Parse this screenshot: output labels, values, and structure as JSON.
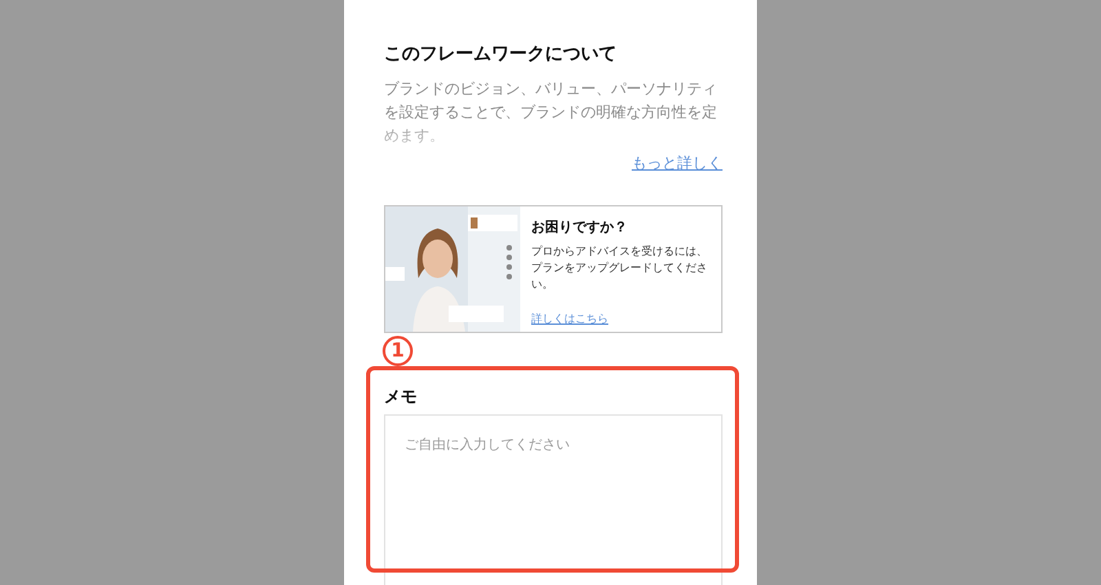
{
  "about": {
    "title": "このフレームワークについて",
    "description": "ブランドのビジョン、バリュー、パーソナリティを設定することで、ブランドの明確な方向性を定めます。",
    "more_link": "もっと詳しく"
  },
  "help_card": {
    "title": "お困りですか？",
    "text": "プロからアドバイスを受けるには、プランをアップグレードしてください。",
    "link": "詳しくはこちら"
  },
  "annotation": {
    "marker": "1"
  },
  "memo": {
    "label": "メモ",
    "placeholder": "ご自由に入力してください"
  }
}
